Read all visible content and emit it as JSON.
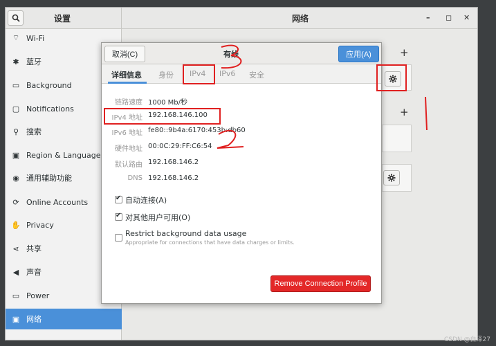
{
  "sidebar": {
    "title": "设置",
    "items": [
      {
        "label": "Wi-Fi",
        "icon": "wifi-icon",
        "glyph": "⌔"
      },
      {
        "label": "蓝牙",
        "icon": "bluetooth-icon",
        "glyph": "✱"
      },
      {
        "label": "Background",
        "icon": "background-icon",
        "glyph": "▭"
      },
      {
        "label": "Notifications",
        "icon": "notifications-icon",
        "glyph": "▢"
      },
      {
        "label": "搜索",
        "icon": "search-icon",
        "glyph": "⚲"
      },
      {
        "label": "Region & Language",
        "icon": "region-icon",
        "glyph": "▣"
      },
      {
        "label": "通用辅助功能",
        "icon": "accessibility-icon",
        "glyph": "◉"
      },
      {
        "label": "Online Accounts",
        "icon": "online-accounts-icon",
        "glyph": "⟳"
      },
      {
        "label": "Privacy",
        "icon": "privacy-icon",
        "glyph": "✋"
      },
      {
        "label": "共享",
        "icon": "share-icon",
        "glyph": "⋖"
      },
      {
        "label": "声音",
        "icon": "sound-icon",
        "glyph": "◀"
      },
      {
        "label": "Power",
        "icon": "power-icon",
        "glyph": "▭"
      },
      {
        "label": "网络",
        "icon": "network-icon",
        "glyph": "▣"
      }
    ],
    "active_index": 12
  },
  "main": {
    "title": "网络"
  },
  "window_controls": {
    "minimize": "–",
    "maximize": "◻",
    "close": "✕"
  },
  "dialog": {
    "title": "有线",
    "cancel_label": "取消(C)",
    "apply_label": "应用(A)",
    "tabs": [
      "详细信息",
      "身份",
      "IPv4",
      "IPv6",
      "安全"
    ],
    "details": [
      {
        "label": "链路速度",
        "value": "1000 Mb/秒"
      },
      {
        "label": "IPv4 地址",
        "value": "192.168.146.100"
      },
      {
        "label": "IPv6 地址",
        "value": "fe80::9b4a:6170:453b:db60"
      },
      {
        "label": "硬件地址",
        "value": "00:0C:29:FF:C6:54"
      },
      {
        "label": "默认路由",
        "value": "192.168.146.2"
      },
      {
        "label": "DNS",
        "value": "192.168.146.2"
      }
    ],
    "auto_connect_label": "自动连接(A)",
    "auto_connect_checked": true,
    "available_all_label": "对其他用户可用(O)",
    "available_all_checked": true,
    "restrict_label": "Restrict background data usage",
    "restrict_sub": "Appropriate for connections that have data charges or limits.",
    "restrict_checked": false,
    "remove_label": "Remove Connection Profile"
  },
  "annotations": {
    "color": "#e02020"
  },
  "accent_color": "#4a90d9",
  "danger_color": "#e32828",
  "watermark": "CSDN @白泽27"
}
